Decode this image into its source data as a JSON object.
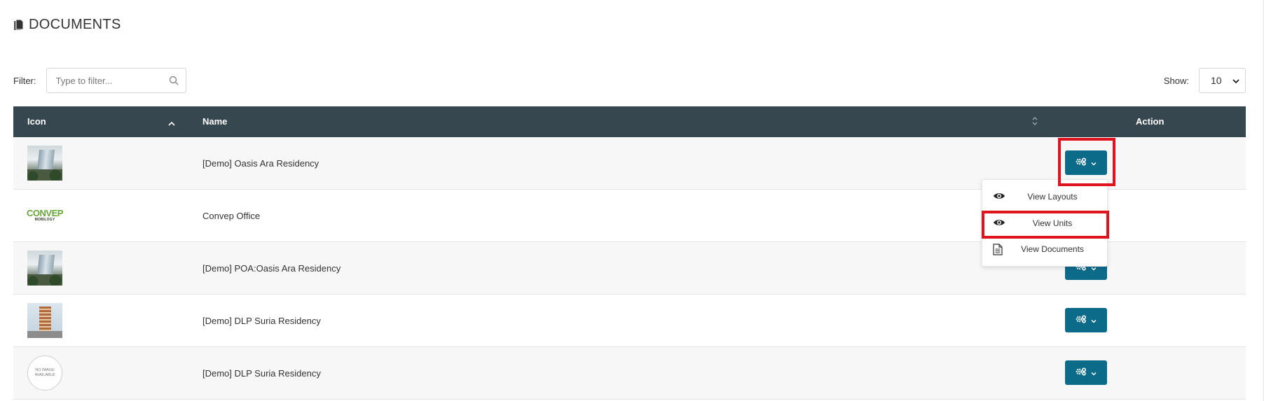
{
  "header": {
    "title": "DOCUMENTS",
    "icon": "documents-icon"
  },
  "filter": {
    "label": "Filter:",
    "placeholder": "Type to filter...",
    "value": ""
  },
  "show": {
    "label": "Show:",
    "selected": "10"
  },
  "table": {
    "columns": {
      "icon": "Icon",
      "name": "Name",
      "action": "Action"
    },
    "rows": [
      {
        "name": "[Demo] Oasis Ara Residency",
        "thumbnail": "building-photo"
      },
      {
        "name": "Convep Office",
        "thumbnail": "convep-logo",
        "logo_top": "CONVEP",
        "logo_bottom": "MOBILOGY"
      },
      {
        "name": "[Demo] POA:Oasis Ara Residency",
        "thumbnail": "building-photo"
      },
      {
        "name": "[Demo] DLP Suria Residency",
        "thumbnail": "tower-photo"
      },
      {
        "name": "[Demo] DLP Suria Residency",
        "thumbnail": "no-image",
        "no_image_line1": "NO IMAGE",
        "no_image_line2": "AVAILABLE"
      }
    ]
  },
  "dropdown": {
    "items": [
      {
        "label": "View Layouts",
        "icon": "eye-icon"
      },
      {
        "label": "View Units",
        "icon": "eye-icon"
      },
      {
        "label": "View Documents",
        "icon": "document-icon"
      }
    ]
  },
  "colors": {
    "header_bg": "#36474f",
    "action_button": "#0d6b8a",
    "highlight": "#e0141e"
  }
}
